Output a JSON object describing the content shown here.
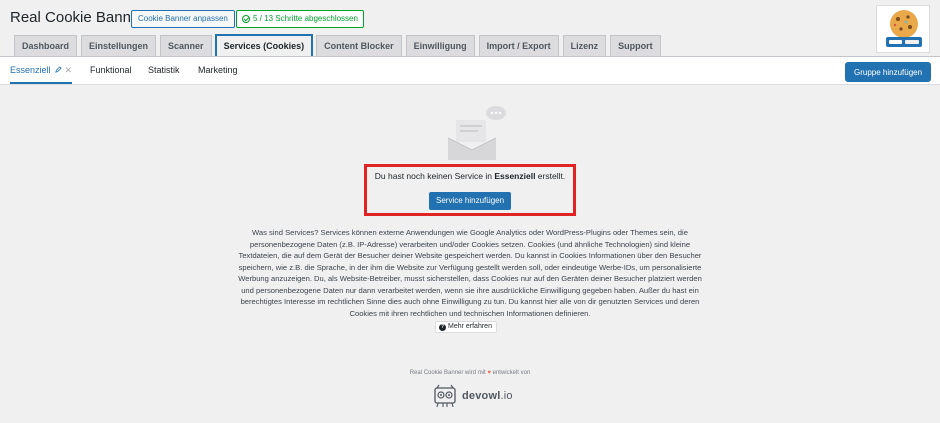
{
  "header": {
    "title": "Real Cookie Banner",
    "customize_button": "Cookie Banner anpassen",
    "progress_button": "5 / 13 Schritte abgeschlossen"
  },
  "tabs": [
    {
      "label": "Dashboard",
      "active": false
    },
    {
      "label": "Einstellungen",
      "active": false
    },
    {
      "label": "Scanner",
      "active": false
    },
    {
      "label": "Services (Cookies)",
      "active": true
    },
    {
      "label": "Content Blocker",
      "active": false
    },
    {
      "label": "Einwilligung",
      "active": false
    },
    {
      "label": "Import / Export",
      "active": false
    },
    {
      "label": "Lizenz",
      "active": false
    },
    {
      "label": "Support",
      "active": false
    }
  ],
  "groups": [
    {
      "label": "Essenziell",
      "active": true
    },
    {
      "label": "Funktional",
      "active": false
    },
    {
      "label": "Statistik",
      "active": false
    },
    {
      "label": "Marketing",
      "active": false
    }
  ],
  "add_group_button": "Gruppe hinzufügen",
  "empty_state": {
    "text_before": "Du hast noch keinen Service in ",
    "group_name": "Essenziell",
    "text_after": " erstellt.",
    "add_service_button": "Service hinzufügen"
  },
  "description": "Was sind Services? Services können externe Anwendungen wie Google Analytics oder WordPress-Plugins oder Themes sein, die personenbezogene Daten (z.B. IP-Adresse) verarbeiten und/oder Cookies setzen. Cookies (und ähnliche Technologien) sind kleine Textdateien, die auf dem Gerät der Besucher deiner Website gespeichert werden. Du kannst in Cookies Informationen über den Besucher speichern, wie z.B. die Sprache, in der ihm die Website zur Verfügung gestellt werden soll, oder eindeutige Werbe-IDs, um personalisierte Werbung anzuzeigen. Du, als Website-Betreiber, musst sicherstellen, dass Cookies nur auf den Geräten deiner Besucher platziert werden und personenbezogene Daten nur dann verarbeitet werden, wenn sie ihre ausdrückliche Einwilligung gegeben haben. Außer du hast ein berechtigtes Interesse im rechtlichen Sinne dies auch ohne Einwilligung zu tun. Du kannst hier alle von dir genutzten Services und deren Cookies mit ihren rechtlichen und technischen Informationen definieren.",
  "learn_more_button": "Mehr erfahren",
  "footer": {
    "text_before": "Real Cookie Banner wird mit ",
    "text_after": " entwickelt von",
    "brand": "devowl",
    "brand_tld": ".io"
  },
  "colors": {
    "primary": "#2271b1",
    "success": "#00a32a",
    "highlight": "#e02424",
    "background": "#f0f0f1"
  },
  "icons": [
    "check-circle-icon",
    "pencil-icon",
    "close-icon",
    "empty-inbox-icon",
    "question-icon",
    "heart-icon",
    "devowl-owl-icon",
    "cookie-logo-icon"
  ]
}
